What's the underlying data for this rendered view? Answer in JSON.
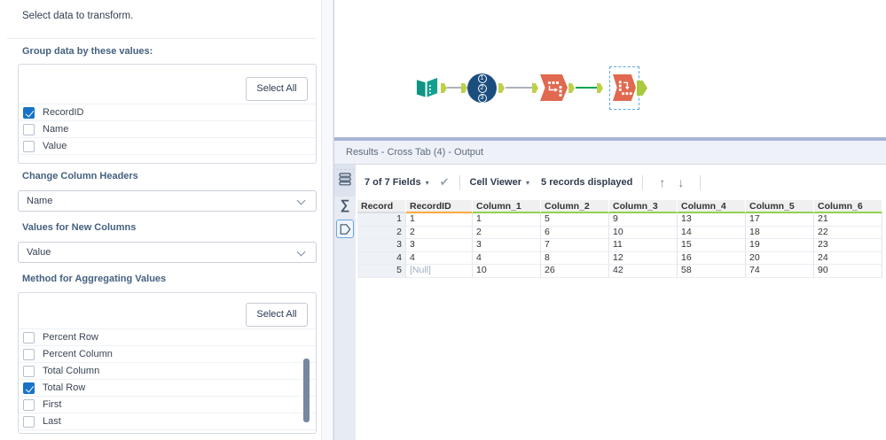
{
  "config_panel": {
    "title": "Select data to transform.",
    "group_by": {
      "label": "Group data by these values:",
      "select_all_label": "Select All",
      "items": [
        {
          "label": "RecordID",
          "checked": true
        },
        {
          "label": "Name",
          "checked": false
        },
        {
          "label": "Value",
          "checked": false
        }
      ]
    },
    "change_column_headers": {
      "label": "Change Column Headers",
      "value": "Name"
    },
    "values_for_new_columns": {
      "label": "Values for New Columns",
      "value": "Value"
    },
    "aggregation": {
      "label": "Method for Aggregating Values",
      "select_all_label": "Select All",
      "items": [
        {
          "label": "Percent Row",
          "checked": false
        },
        {
          "label": "Percent Column",
          "checked": false
        },
        {
          "label": "Total Column",
          "checked": false
        },
        {
          "label": "Total Row",
          "checked": true
        },
        {
          "label": "First",
          "checked": false
        },
        {
          "label": "Last",
          "checked": false
        }
      ]
    }
  },
  "canvas": {
    "tools": [
      {
        "name": "text-input",
        "icon": "open-book-icon"
      },
      {
        "name": "record-id",
        "icon": "numbered-circle-icon"
      },
      {
        "name": "transpose",
        "icon": "transpose-icon"
      },
      {
        "name": "cross-tab",
        "icon": "cross-tab-icon",
        "selected": true
      }
    ],
    "record_id_digits": [
      "1",
      "2",
      "3"
    ]
  },
  "results": {
    "title": "Results - Cross Tab (4) - Output",
    "toolbar": {
      "fields": "7 of 7 Fields",
      "cell_viewer": "Cell Viewer",
      "records": "5 records displayed"
    },
    "table": {
      "columns": [
        "Record",
        "RecordID",
        "Column_1",
        "Column_2",
        "Column_3",
        "Column_4",
        "Column_5",
        "Column_6"
      ],
      "header_underlines": [
        "none",
        "orange",
        "green",
        "green",
        "green",
        "green",
        "green",
        "green"
      ],
      "rows": [
        [
          "1",
          "1",
          "1",
          "5",
          "9",
          "13",
          "17",
          "21"
        ],
        [
          "2",
          "2",
          "2",
          "6",
          "10",
          "14",
          "18",
          "22"
        ],
        [
          "3",
          "3",
          "3",
          "7",
          "11",
          "15",
          "19",
          "23"
        ],
        [
          "4",
          "4",
          "4",
          "8",
          "12",
          "16",
          "20",
          "24"
        ],
        [
          "5",
          "[Null]",
          "10",
          "26",
          "42",
          "58",
          "74",
          "90"
        ]
      ],
      "null_display": "[Null]"
    }
  },
  "icons": {
    "dropdown_caret": "▾",
    "check_mark": "✔",
    "scroll_up": "↑",
    "scroll_down": "↓",
    "sigma": "∑",
    "grip_dots": "·····"
  },
  "colors": {
    "checkbox_checked": "#1673c7",
    "grid_underline_green": "#92d050",
    "grid_underline_orange": "#ffa940",
    "tool_orange": "#e0694f",
    "tool_teal": "#12a08d",
    "tool_navy": "#1b4e7e",
    "anchor_lime": "#bed04b",
    "connection_green": "#00a550",
    "connection_gray": "#adb3ba",
    "selection_blue": "#58a6e8",
    "splitter_blue": "#a9b5d6"
  }
}
